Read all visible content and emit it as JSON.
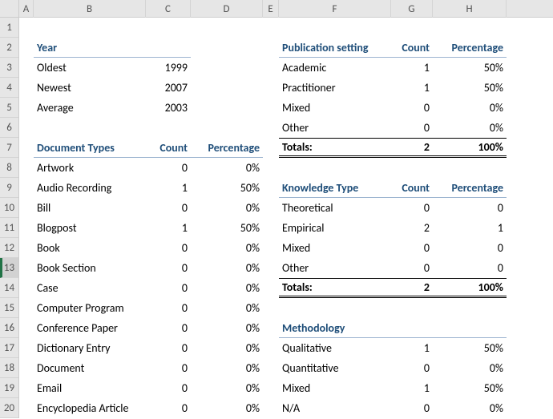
{
  "columns": [
    "A",
    "B",
    "C",
    "D",
    "E",
    "F",
    "G",
    "H"
  ],
  "rowCount": 20,
  "selectedRow": 13,
  "left": {
    "year": {
      "header": "Year",
      "rows": [
        {
          "label": "Oldest",
          "value": "1999"
        },
        {
          "label": "Newest",
          "value": "2007"
        },
        {
          "label": "Average",
          "value": "2003"
        }
      ]
    },
    "docTypes": {
      "header": "Document Types",
      "countHeader": "Count",
      "pctHeader": "Percentage",
      "rows": [
        {
          "label": "Artwork",
          "count": "0",
          "pct": "0%"
        },
        {
          "label": "Audio Recording",
          "count": "1",
          "pct": "50%"
        },
        {
          "label": "Bill",
          "count": "0",
          "pct": "0%"
        },
        {
          "label": "Blogpost",
          "count": "1",
          "pct": "50%"
        },
        {
          "label": "Book",
          "count": "0",
          "pct": "0%"
        },
        {
          "label": "Book Section",
          "count": "0",
          "pct": "0%"
        },
        {
          "label": "Case",
          "count": "0",
          "pct": "0%"
        },
        {
          "label": "Computer Program",
          "count": "0",
          "pct": "0%"
        },
        {
          "label": "Conference Paper",
          "count": "0",
          "pct": "0%"
        },
        {
          "label": "Dictionary Entry",
          "count": "0",
          "pct": "0%"
        },
        {
          "label": "Document",
          "count": "0",
          "pct": "0%"
        },
        {
          "label": "Email",
          "count": "0",
          "pct": "0%"
        },
        {
          "label": "Encyclopedia Article",
          "count": "0",
          "pct": "0%"
        }
      ]
    }
  },
  "right": {
    "pubSetting": {
      "header": "Publication setting",
      "countHeader": "Count",
      "pctHeader": "Percentage",
      "rows": [
        {
          "label": "Academic",
          "count": "1",
          "pct": "50%"
        },
        {
          "label": "Practitioner",
          "count": "1",
          "pct": "50%"
        },
        {
          "label": "Mixed",
          "count": "0",
          "pct": "0%"
        },
        {
          "label": "Other",
          "count": "0",
          "pct": "0%"
        }
      ],
      "totals": {
        "label": "Totals:",
        "count": "2",
        "pct": "100%"
      }
    },
    "knowType": {
      "header": "Knowledge Type",
      "countHeader": "Count",
      "pctHeader": "Percentage",
      "rows": [
        {
          "label": "Theoretical",
          "count": "0",
          "pct": "0"
        },
        {
          "label": "Empirical",
          "count": "2",
          "pct": "1"
        },
        {
          "label": "Mixed",
          "count": "0",
          "pct": "0"
        },
        {
          "label": "Other",
          "count": "0",
          "pct": "0"
        }
      ],
      "totals": {
        "label": "Totals:",
        "count": "2",
        "pct": "100%"
      }
    },
    "methodology": {
      "header": "Methodology",
      "rows": [
        {
          "label": "Qualitative",
          "count": "1",
          "pct": "50%"
        },
        {
          "label": "Quantitative",
          "count": "0",
          "pct": "0%"
        },
        {
          "label": "Mixed",
          "count": "1",
          "pct": "50%"
        },
        {
          "label": "N/A",
          "count": "0",
          "pct": "0%"
        }
      ]
    }
  }
}
